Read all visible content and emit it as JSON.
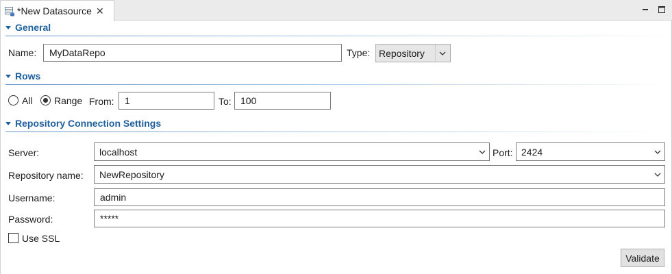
{
  "tab": {
    "title": "*New Datasource",
    "close": "✕"
  },
  "general": {
    "title": "General",
    "name_label": "Name:",
    "name_value": "MyDataRepo",
    "type_label": "Type:",
    "type_value": "Repository"
  },
  "rows": {
    "title": "Rows",
    "all_label": "All",
    "range_label": "Range",
    "selected": "Range",
    "from_label": "From:",
    "from_value": "1",
    "to_label": "To:",
    "to_value": "100"
  },
  "repo": {
    "title": "Repository Connection Settings",
    "server_label": "Server:",
    "server_value": "localhost",
    "port_label": "Port:",
    "port_value": "2424",
    "repo_name_label": "Repository name:",
    "repo_name_value": "NewRepository",
    "username_label": "Username:",
    "username_value": "admin",
    "password_label": "Password:",
    "password_value": "*****",
    "ssl_label": "Use SSL",
    "ssl_checked": false,
    "validate_label": "Validate"
  },
  "colors": {
    "section_title": "#1e5f9e",
    "border": "#7a7a7a"
  }
}
